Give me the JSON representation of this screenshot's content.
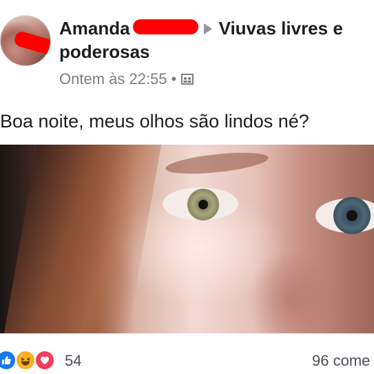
{
  "post": {
    "author_name": "Amanda",
    "group_name": "Viuvas livres e poderosas",
    "timestamp": "Ontem às 22:55",
    "meta_separator": "•",
    "privacy_icon": "group-icon",
    "text": "Boa noite, meus olhos são lindos né?"
  },
  "footer": {
    "reaction_icons": [
      "like-icon",
      "haha-icon",
      "love-icon"
    ],
    "reaction_count": "54",
    "comments_label": "96 come"
  },
  "colors": {
    "redaction": "#ff0000",
    "like": "#1877f2",
    "haha": "#f7b125",
    "love": "#f33e58",
    "meta_gray": "#7a7d82"
  }
}
